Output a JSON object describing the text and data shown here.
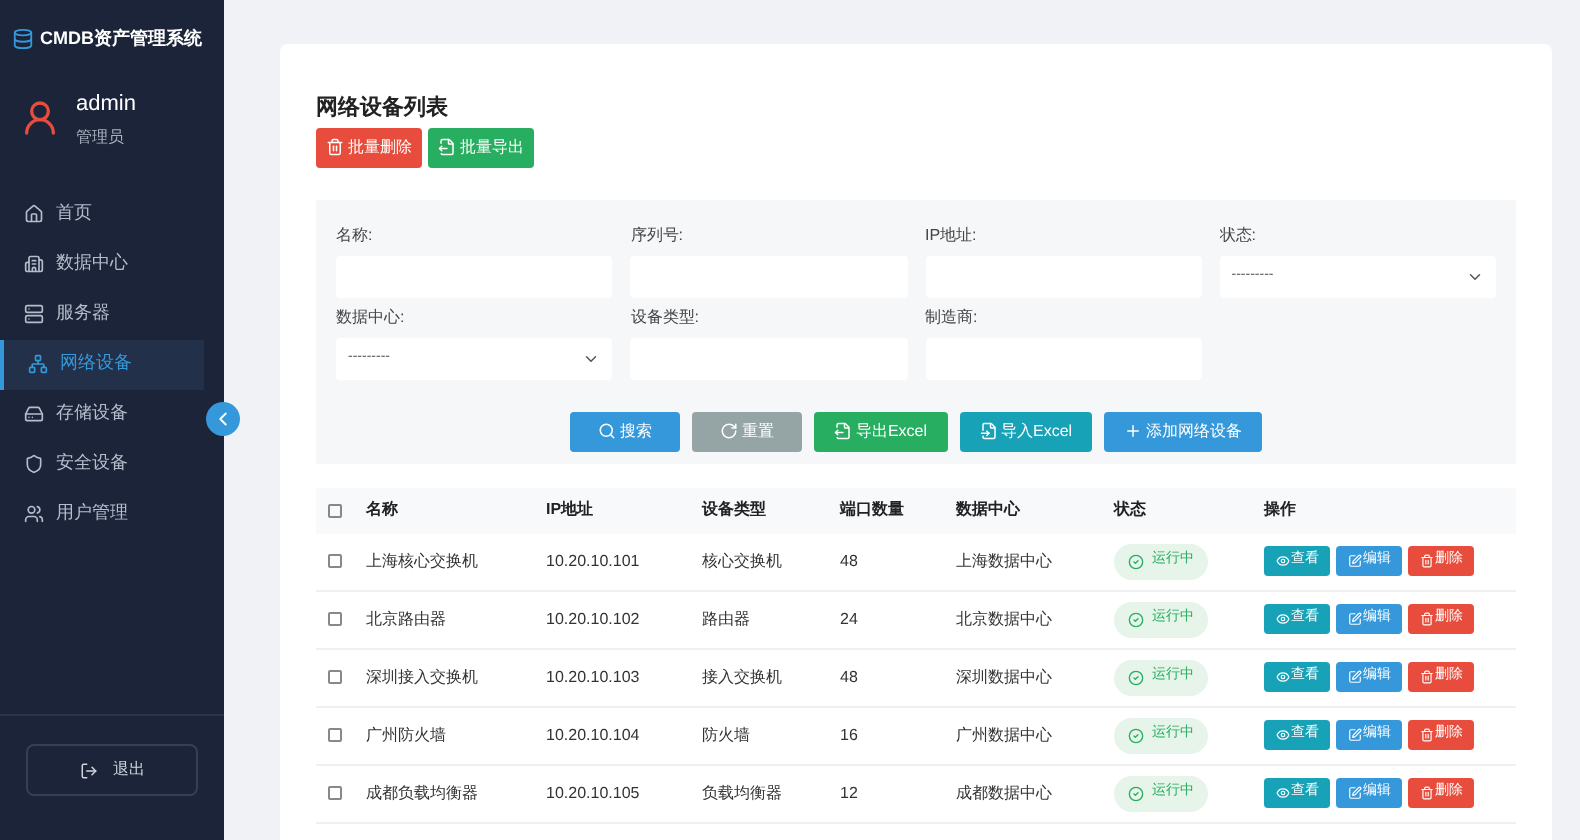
{
  "sidebar": {
    "title": "CMDB资产管理系统",
    "user": {
      "name": "admin",
      "role": "管理员"
    },
    "items": [
      {
        "label": "首页",
        "selected": false
      },
      {
        "label": "数据中心",
        "selected": false
      },
      {
        "label": "服务器",
        "selected": false
      },
      {
        "label": "网络设备",
        "selected": true
      },
      {
        "label": "存储设备",
        "selected": false
      },
      {
        "label": "安全设备",
        "selected": false
      },
      {
        "label": "用户管理",
        "selected": false
      }
    ],
    "logout": "退出"
  },
  "page": {
    "title": "网络设备列表",
    "bulk_actions": [
      {
        "label": "批量删除",
        "kind": "delete"
      },
      {
        "label": "批量导出",
        "kind": "export"
      }
    ]
  },
  "filters": [
    {
      "label": "名称:",
      "kind": "text"
    },
    {
      "label": "序列号:",
      "kind": "text"
    },
    {
      "label": "IP地址:",
      "kind": "text"
    },
    {
      "label": "状态:",
      "kind": "select",
      "value": "---------"
    },
    {
      "label": "数据中心:",
      "kind": "select",
      "value": "---------"
    },
    {
      "label": "设备类型:",
      "kind": "text"
    },
    {
      "label": "制造商:",
      "kind": "text"
    }
  ],
  "filter_buttons": [
    {
      "label": "搜索",
      "kind": "search"
    },
    {
      "label": "重置",
      "kind": "reset"
    },
    {
      "label": "导出Excel",
      "kind": "export"
    },
    {
      "label": "导入Excel",
      "kind": "import"
    },
    {
      "label": "添加网络设备",
      "kind": "add"
    }
  ],
  "table": {
    "select_all_checked": false,
    "columns": [
      "名称",
      "IP地址",
      "设备类型",
      "端口数量",
      "数据中心",
      "状态",
      "操作"
    ],
    "rows": [
      {
        "checked": false,
        "cells": [
          "上海核心交换机",
          "10.20.10.101",
          "核心交换机",
          "48",
          "上海数据中心"
        ],
        "status": "运行中",
        "actions": [
          {
            "label": "查看",
            "kind": "view"
          },
          {
            "label": "编辑",
            "kind": "edit"
          },
          {
            "label": "删除",
            "kind": "delete"
          }
        ]
      },
      {
        "checked": false,
        "cells": [
          "北京路由器",
          "10.20.10.102",
          "路由器",
          "24",
          "北京数据中心"
        ],
        "status": "运行中",
        "actions": [
          {
            "label": "查看",
            "kind": "view"
          },
          {
            "label": "编辑",
            "kind": "edit"
          },
          {
            "label": "删除",
            "kind": "delete"
          }
        ]
      },
      {
        "checked": false,
        "cells": [
          "深圳接入交换机",
          "10.20.10.103",
          "接入交换机",
          "48",
          "深圳数据中心"
        ],
        "status": "运行中",
        "actions": [
          {
            "label": "查看",
            "kind": "view"
          },
          {
            "label": "编辑",
            "kind": "edit"
          },
          {
            "label": "删除",
            "kind": "delete"
          }
        ]
      },
      {
        "checked": false,
        "cells": [
          "广州防火墙",
          "10.20.10.104",
          "防火墙",
          "16",
          "广州数据中心"
        ],
        "status": "运行中",
        "actions": [
          {
            "label": "查看",
            "kind": "view"
          },
          {
            "label": "编辑",
            "kind": "edit"
          },
          {
            "label": "删除",
            "kind": "delete"
          }
        ]
      },
      {
        "checked": false,
        "cells": [
          "成都负载均衡器",
          "10.20.10.105",
          "负载均衡器",
          "12",
          "成都数据中心"
        ],
        "status": "运行中",
        "actions": [
          {
            "label": "查看",
            "kind": "view"
          },
          {
            "label": "编辑",
            "kind": "edit"
          },
          {
            "label": "删除",
            "kind": "delete"
          }
        ]
      }
    ]
  }
}
